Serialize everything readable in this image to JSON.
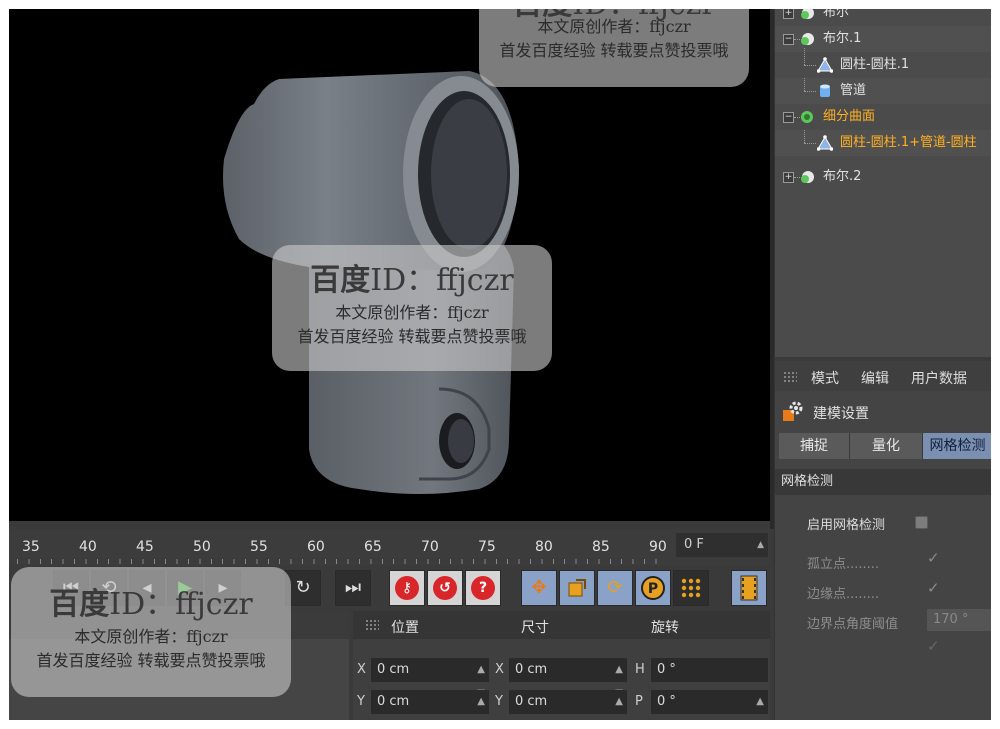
{
  "object_manager": {
    "items": [
      {
        "label": "布尔",
        "icon": "boole-icon",
        "highlight": false
      },
      {
        "label": "布尔.1",
        "icon": "boole-icon",
        "highlight": false
      },
      {
        "label": "圆柱-圆柱.1",
        "icon": "polygon-object-icon",
        "highlight": false
      },
      {
        "label": "管道",
        "icon": "tube-icon",
        "highlight": false
      },
      {
        "label": "细分曲面",
        "icon": "subdivision-surface-icon",
        "highlight": true
      },
      {
        "label": "圆柱-圆柱.1+管道-圆柱",
        "icon": "polygon-object-icon",
        "highlight": true
      },
      {
        "label": "布尔.2",
        "icon": "boole-icon",
        "highlight": false
      }
    ]
  },
  "attributes": {
    "menu": [
      "模式",
      "编辑",
      "用户数据"
    ],
    "title": "建模设置",
    "tabs": [
      "捕捉",
      "量化",
      "网格检测"
    ],
    "active_tab": "网格检测",
    "section": "网格检测",
    "enable_label": "启用网格检测",
    "props": [
      {
        "label": "孤立点",
        "dots": "........",
        "checked": true
      },
      {
        "label": "边缘点",
        "dots": "........",
        "checked": true
      }
    ],
    "angle_label": "边界点角度阈值",
    "angle_value": "170 °"
  },
  "timeline": {
    "ticks": [
      "35",
      "40",
      "45",
      "50",
      "55",
      "60",
      "65",
      "70",
      "75",
      "80",
      "85",
      "90"
    ],
    "current_frame": "0 F"
  },
  "coordinates": {
    "headers": [
      "位置",
      "尺寸",
      "旋转"
    ],
    "rows": [
      {
        "pos_axis": "X",
        "pos": "0 cm",
        "size_axis": "X",
        "size": "0 cm",
        "rot_axis": "H",
        "rot": "0 °"
      },
      {
        "pos_axis": "Y",
        "pos": "0 cm",
        "size_axis": "Y",
        "size": "0 cm",
        "rot_axis": "P",
        "rot": "0 °"
      }
    ]
  },
  "watermark": {
    "title_cn": "百度",
    "title_id": "ID：ffjczr",
    "line2": "本文原创作者：ffjczr",
    "line3": "首发百度经验 转载要点赞投票哦",
    "top_line2": "本文原创作者：ffjczr",
    "top_line3": "首发百度经验 转载要点赞投票哦"
  },
  "colors": {
    "highlight_text": "#ffb020",
    "active_tab": "#7b8fb0",
    "viewport_bg": "#000000",
    "model_gray": "#6b7178"
  }
}
